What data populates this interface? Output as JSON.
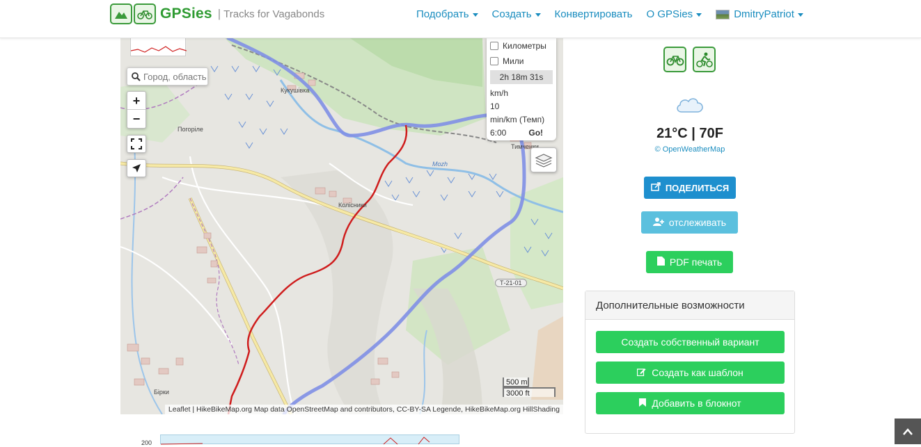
{
  "brand": {
    "name": "GPSies",
    "separator": "|",
    "tagline": "Tracks for Vagabonds"
  },
  "nav": {
    "items": [
      {
        "label": "Подобрать"
      },
      {
        "label": "Создать"
      },
      {
        "label": "Конвертировать"
      },
      {
        "label": "O GPSies"
      },
      {
        "label": "DmitryPatriot"
      }
    ]
  },
  "map": {
    "search_placeholder": "Город, область",
    "zoom_in": "+",
    "zoom_out": "−",
    "speed_panel": {
      "km_label": "Километры",
      "miles_label": "Мили",
      "duration": "2h 18m 31s",
      "kmh_label": "km/h",
      "kmh_value": "10",
      "pace_label": "min/km (Темп)",
      "pace_value": "6:00",
      "go_label": "Go!"
    },
    "places": [
      "Кукушівка",
      "Погоріле",
      "Колісники",
      "Тимченки",
      "Бірки",
      "Mozh",
      "Т-21-01"
    ],
    "scale": {
      "metric": "500 m",
      "imperial": "3000 ft"
    },
    "attribution": "Leaflet | HikeBikeMap.org Map data OpenStreetMap and contributors, CC-BY-SA Legende, HikeBikeMap.org HillShading"
  },
  "weather": {
    "temp": "21°C | 70F",
    "source": "© OpenWeatherMap"
  },
  "buttons": {
    "share": "ПОДЕЛИТЬСЯ",
    "track": "отслеживать",
    "pdf": "PDF печать"
  },
  "extras": {
    "title": "Дополнительные возможности",
    "create_own": "Создать собственный вариант",
    "create_template": "Создать как шаблон",
    "add_notebook": "Добавить в блокнот"
  },
  "elevation": {
    "tick_label": "200"
  },
  "colors": {
    "brand_green": "#2f9b32",
    "link_blue": "#1a8dbf",
    "share_blue": "#1e8fce",
    "track_cyan": "#5bc0de",
    "action_green": "#2ccf5d"
  }
}
